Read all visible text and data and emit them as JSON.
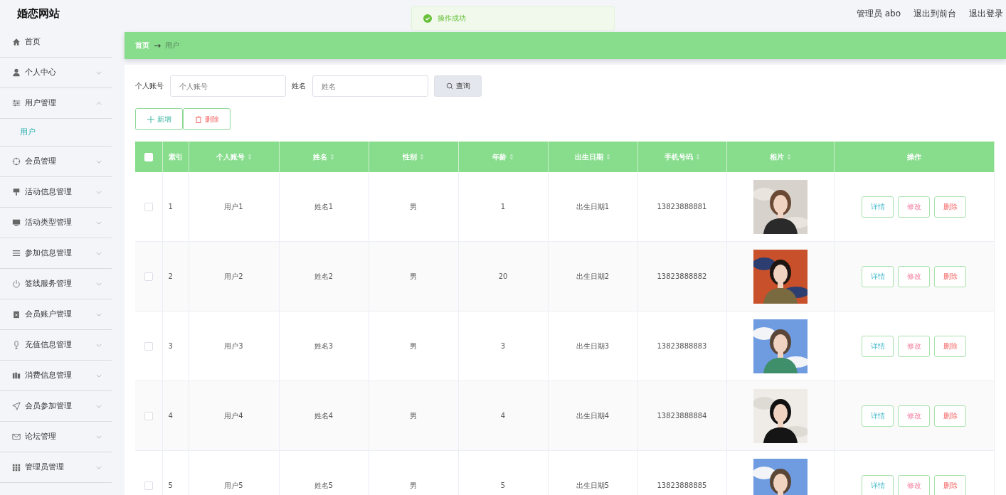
{
  "header": {
    "title": "婚恋网站",
    "user": "管理员 abo",
    "links": [
      "退出到前台",
      "退出登录"
    ]
  },
  "toast": {
    "kind": "success",
    "message": "操作成功"
  },
  "sidebar": {
    "items": [
      {
        "label": "首页",
        "kind": "link"
      },
      {
        "label": "个人中心",
        "kind": "submenu",
        "expanded": false
      },
      {
        "label": "用户管理",
        "kind": "submenu",
        "expanded": true,
        "children": [
          {
            "label": "用户",
            "selected": true
          }
        ]
      },
      {
        "label": "会员管理",
        "kind": "submenu",
        "expanded": false
      },
      {
        "label": "活动信息管理",
        "kind": "submenu",
        "expanded": false
      },
      {
        "label": "活动类型管理",
        "kind": "submenu",
        "expanded": false
      },
      {
        "label": "参加信息管理",
        "kind": "submenu",
        "expanded": false
      },
      {
        "label": "签线服务管理",
        "kind": "submenu",
        "expanded": false
      },
      {
        "label": "会员账户管理",
        "kind": "submenu",
        "expanded": false
      },
      {
        "label": "充值信息管理",
        "kind": "submenu",
        "expanded": false
      },
      {
        "label": "消费信息管理",
        "kind": "submenu",
        "expanded": false
      },
      {
        "label": "会员参加管理",
        "kind": "submenu",
        "expanded": false
      },
      {
        "label": "论坛管理",
        "kind": "submenu",
        "expanded": false
      },
      {
        "label": "管理员管理",
        "kind": "submenu",
        "expanded": false
      }
    ]
  },
  "breadcrumb": {
    "items": [
      "首页",
      "用户"
    ],
    "separator": "→"
  },
  "search": {
    "fields": [
      {
        "label": "个人账号",
        "placeholder": "个人账号"
      },
      {
        "label": "姓名",
        "placeholder": "姓名"
      }
    ],
    "button": "查询"
  },
  "actions": [
    {
      "kind": "add",
      "label": "新增"
    },
    {
      "kind": "delete",
      "label": "删除"
    }
  ],
  "table": {
    "select_all": {
      "checked": false
    },
    "columns": [
      {
        "label": "索引",
        "sortable": false
      },
      {
        "label": "个人账号",
        "sortable": true
      },
      {
        "label": "姓名",
        "sortable": true
      },
      {
        "label": "性别",
        "sortable": true
      },
      {
        "label": "年龄",
        "sortable": true
      },
      {
        "label": "出生日期",
        "sortable": true
      },
      {
        "label": "手机号码",
        "sortable": true
      },
      {
        "label": "相片",
        "sortable": true
      },
      {
        "label": "操作",
        "sortable": false
      }
    ],
    "rows": [
      {
        "checked": false,
        "cells": [
          "1",
          "用户1",
          "姓名1",
          "男",
          "1",
          "出生日期1",
          "13823888881"
        ],
        "actions": [
          {
            "kind": "detail",
            "label": "详情"
          },
          {
            "kind": "edit",
            "label": "修改"
          },
          {
            "kind": "delete",
            "label": "删除"
          }
        ]
      },
      {
        "checked": false,
        "cells": [
          "2",
          "用户2",
          "姓名2",
          "男",
          "20",
          "出生日期2",
          "13823888882"
        ],
        "actions": [
          {
            "kind": "detail",
            "label": "详情"
          },
          {
            "kind": "edit",
            "label": "修改"
          },
          {
            "kind": "delete",
            "label": "删除"
          }
        ]
      },
      {
        "checked": false,
        "cells": [
          "3",
          "用户3",
          "姓名3",
          "男",
          "3",
          "出生日期3",
          "13823888883"
        ],
        "actions": [
          {
            "kind": "detail",
            "label": "详情"
          },
          {
            "kind": "edit",
            "label": "修改"
          },
          {
            "kind": "delete",
            "label": "删除"
          }
        ]
      },
      {
        "checked": false,
        "cells": [
          "4",
          "用户4",
          "姓名4",
          "男",
          "4",
          "出生日期4",
          "13823888884"
        ],
        "actions": [
          {
            "kind": "detail",
            "label": "详情"
          },
          {
            "kind": "edit",
            "label": "修改"
          },
          {
            "kind": "delete",
            "label": "删除"
          }
        ]
      },
      {
        "checked": false,
        "cells": [
          "5",
          "用户5",
          "姓名5",
          "男",
          "5",
          "出生日期5",
          "13823888885"
        ],
        "actions": [
          {
            "kind": "detail",
            "label": "详情"
          },
          {
            "kind": "edit",
            "label": "修改"
          },
          {
            "kind": "delete",
            "label": "删除"
          }
        ]
      }
    ]
  }
}
